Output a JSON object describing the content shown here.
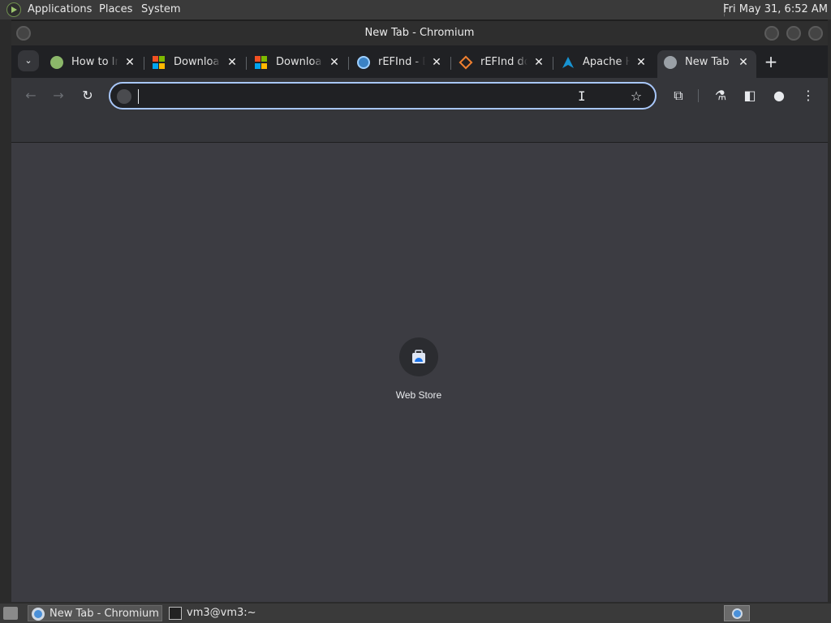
{
  "top_panel": {
    "menus": [
      "Applications",
      "Places",
      "System"
    ],
    "clock": "Fri May 31,  6:52 AM"
  },
  "window": {
    "title": "New Tab - Chromium"
  },
  "tabs": [
    {
      "title": "How to In",
      "favicon": "green-c-icon"
    },
    {
      "title": "Downloa",
      "favicon": "microsoft-icon"
    },
    {
      "title": "Downloa",
      "favicon": "microsoft-icon"
    },
    {
      "title": "rEFInd - D",
      "favicon": "refind-globe-icon"
    },
    {
      "title": "rEFInd do",
      "favicon": "orange-diamond-icon"
    },
    {
      "title": "Apache H",
      "favicon": "arch-linux-icon"
    },
    {
      "title": "New Tab",
      "favicon": "globe-icon",
      "active": true
    }
  ],
  "toolbar": {
    "back": "←",
    "forward": "→",
    "reload": "↻",
    "star": "☆",
    "extensions": "⧉",
    "labs": "⚗",
    "sidepanel": "◧",
    "profile": "●",
    "menu": "⋮"
  },
  "omnibox": {
    "value": "",
    "placeholder": ""
  },
  "shortcuts": [
    {
      "label": "Web Store"
    }
  ],
  "taskbar": {
    "tasks": [
      "New Tab - Chromium",
      "vm3@vm3:~"
    ]
  },
  "colors": {
    "accent": "#a8c7fa",
    "content_bg": "#3c3c42",
    "toolbar_bg": "#35363a",
    "tabstrip_bg": "#202124"
  }
}
